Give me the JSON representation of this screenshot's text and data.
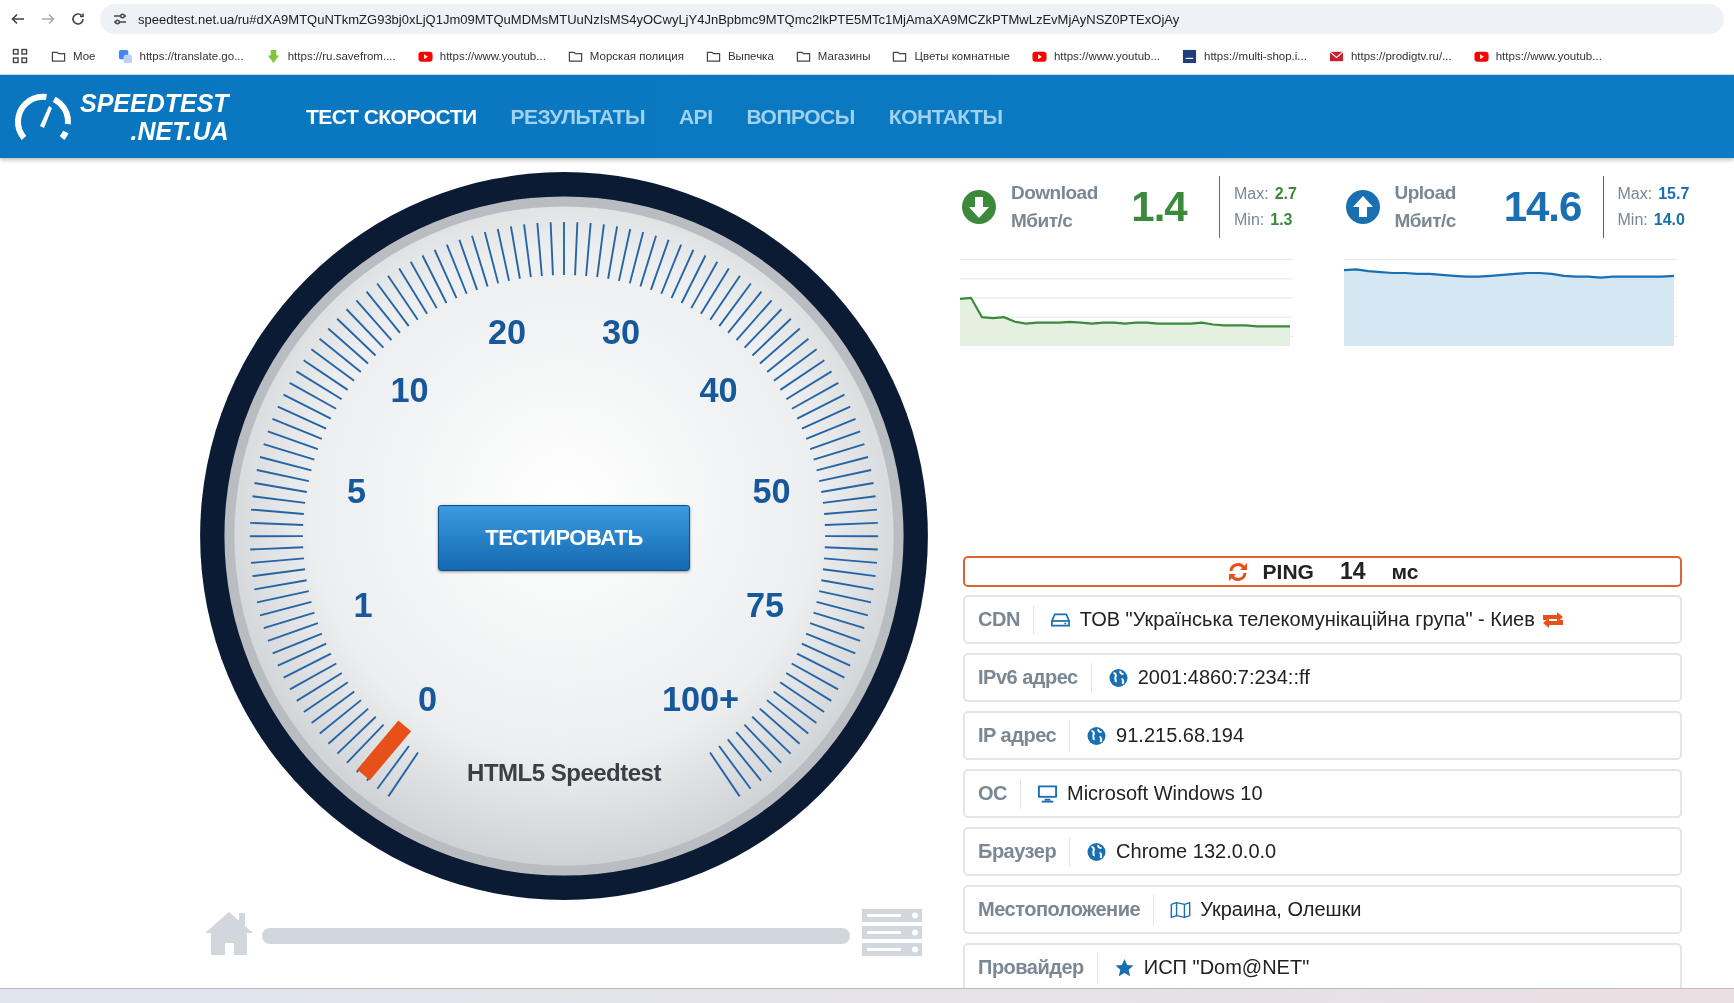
{
  "browser": {
    "url": "speedtest.net.ua/ru#dXA9MTQuNTkmZG93bj0xLjQ1Jm09MTQuMDMsMTUuNzIsMS4yOCwyLjY4JnBpbmc9MTQmc2lkPTE5MTc1MjAmaXA9MCZkPTMwLzEvMjAyNSZ0PTExOjAy",
    "bookmarks": [
      {
        "label": "Мое",
        "kind": "folder"
      },
      {
        "label": "https://translate.go...",
        "kind": "translate"
      },
      {
        "label": "https://ru.savefrom....",
        "kind": "download"
      },
      {
        "label": "https://www.youtub...",
        "kind": "video"
      },
      {
        "label": "Морская полиция",
        "kind": "folder"
      },
      {
        "label": "Выпечка",
        "kind": "folder"
      },
      {
        "label": "Магазины",
        "kind": "folder"
      },
      {
        "label": "Цветы комнатные",
        "kind": "folder"
      },
      {
        "label": "https://www.youtub...",
        "kind": "video"
      },
      {
        "label": "https://multi-shop.i...",
        "kind": "shop"
      },
      {
        "label": "https://prodigtv.ru/...",
        "kind": "mail"
      },
      {
        "label": "https://www.youtub...",
        "kind": "video"
      }
    ]
  },
  "site": {
    "logo": {
      "line1": "SPEEDTEST",
      "line2": ".NET.UA"
    },
    "nav": [
      {
        "label": "ТЕСТ СКОРОСТИ",
        "selected": true
      },
      {
        "label": "РЕЗУЛЬТАТЫ",
        "selected": false
      },
      {
        "label": "API",
        "selected": false
      },
      {
        "label": "ВОПРОСЫ",
        "selected": false
      },
      {
        "label": "КОНТАКТЫ",
        "selected": false
      }
    ]
  },
  "gauge": {
    "scale": [
      "0",
      "1",
      "5",
      "10",
      "20",
      "30",
      "40",
      "50",
      "75",
      "100+"
    ],
    "button": "ТЕСТИРОВАТЬ",
    "caption": "HTML5 Speedtest"
  },
  "results": [
    {
      "kind": "download",
      "label": "Download",
      "unit": "Мбит/с",
      "value": "1.4",
      "max_label": "Max:",
      "max": "2.7",
      "min_label": "Min:",
      "min": "1.3"
    },
    {
      "kind": "upload",
      "label": "Upload",
      "unit": "Мбит/с",
      "value": "14.6",
      "max_label": "Max:",
      "max": "15.7",
      "min_label": "Min:",
      "min": "14.0"
    }
  ],
  "ping": {
    "label": "PING",
    "value": "14",
    "unit": "мс"
  },
  "info": [
    {
      "label": "CDN",
      "kind": "server",
      "value": "ТОВ \"Українська телекомунікаційна група\" - Киев"
    },
    {
      "label": "IPv6 адрес",
      "kind": "globe",
      "value": "2001:4860:7:234::ff"
    },
    {
      "label": "IP адрес",
      "kind": "globe",
      "value": "91.215.68.194"
    },
    {
      "label": "ОС",
      "kind": "monitor",
      "value": "Microsoft Windows 10"
    },
    {
      "label": "Браузер",
      "kind": "globe",
      "value": "Chrome 132.0.0.0"
    },
    {
      "label": "Местоположение",
      "kind": "map",
      "value": "Украина, Олешки"
    },
    {
      "label": "Провайдер",
      "kind": "star",
      "value": "ИСП \"Dom@NET\""
    }
  ]
}
